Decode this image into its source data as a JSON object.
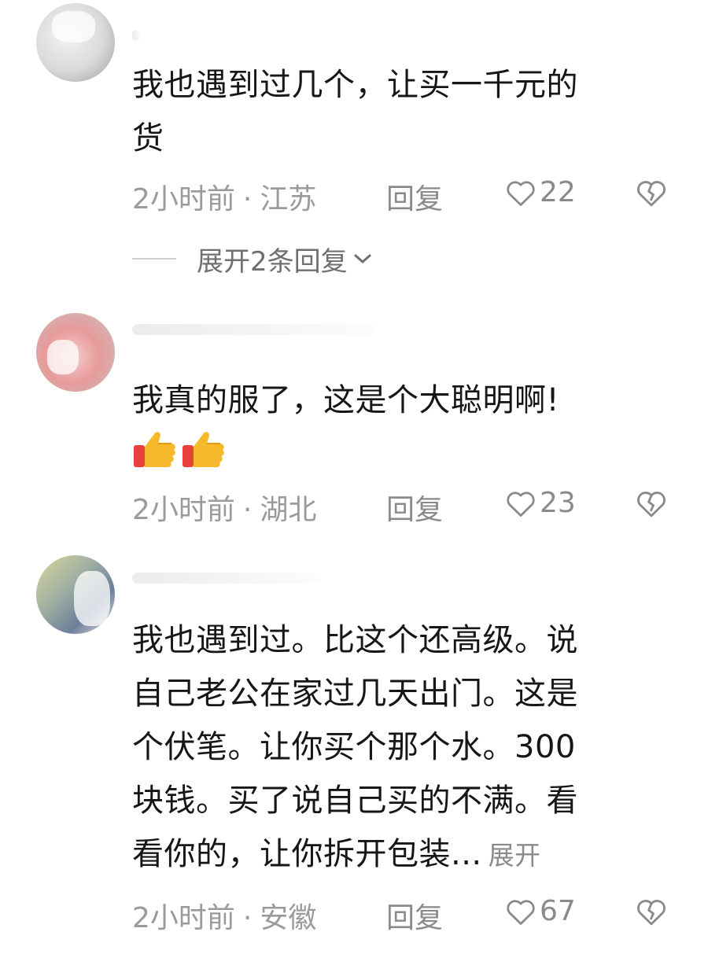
{
  "comments": [
    {
      "body_lines": [
        "我也遇到过几个，让买一千元的",
        "货"
      ],
      "time": "2小时前",
      "location": "江苏",
      "reply_label": "回复",
      "likes": "22",
      "replies_toggle": "展开2条回复"
    },
    {
      "body_lines": [
        "我真的服了，这是个大聪明啊!"
      ],
      "emojis": [
        "thumbs-up",
        "thumbs-up"
      ],
      "time": "2小时前",
      "location": "湖北",
      "reply_label": "回复",
      "likes": "23"
    },
    {
      "body_lines": [
        "我也遇到过。比这个还高级。说",
        "自己老公在家过几天出门。这是",
        "个伏笔。让你买个那个水。300",
        "块钱。买了说自己买的不满。看",
        "看你的，让你拆开包装..."
      ],
      "expand_label": "展开",
      "time": "2小时前",
      "location": "安徽",
      "reply_label": "回复",
      "likes": "67"
    }
  ],
  "separator": "·",
  "colors": {
    "text": "#161616",
    "meta": "#9a9a9a",
    "thumb": "#f6b92b"
  }
}
